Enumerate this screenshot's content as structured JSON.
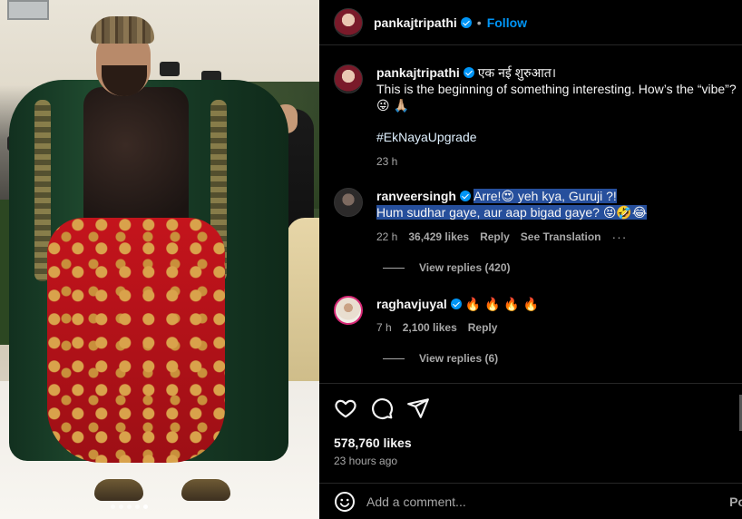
{
  "header": {
    "username": "pankajtripathi",
    "separator": "•",
    "follow_label": "Follow"
  },
  "caption": {
    "username": "pankajtripathi",
    "hindi_text": "एक नई शुरुआत।",
    "line2": "This is the beginning of something interesting. How’s the “vibe”?",
    "emojis": "😜 🙏🏼",
    "hashtag": "#EkNayaUpgrade",
    "time": "23 h"
  },
  "comments": [
    {
      "username": "ranveersingh",
      "line1": "Arre!😍 yeh kya, Guruji ?!",
      "line2": "Hum sudhar gaye, aur aap bigad gaye? 😝🤣😂",
      "time": "22 h",
      "likes": "36,429 likes",
      "reply": "Reply",
      "translate": "See Translation",
      "more": "···",
      "view_replies": "View replies (420)"
    },
    {
      "username": "raghavjuyal",
      "text": "🔥 🔥 🔥 🔥",
      "time": "7 h",
      "likes": "2,100 likes",
      "reply": "Reply",
      "view_replies": "View replies (6)"
    }
  ],
  "actions": {
    "likes": "578,760 likes",
    "posted": "23 hours ago"
  },
  "add_comment": {
    "placeholder": "Add a comment...",
    "post_label": "Po"
  },
  "icons": {
    "like": "heart-icon",
    "comment": "speech-bubble-icon",
    "share": "paper-plane-icon",
    "emoji": "smiley-icon"
  },
  "colors": {
    "accent": "#0095f6",
    "background": "#000000",
    "highlight": "#264f9c"
  }
}
